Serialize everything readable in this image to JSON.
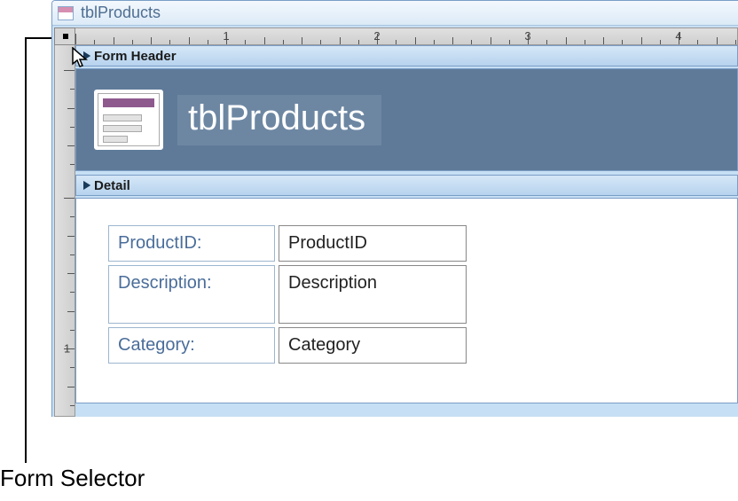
{
  "window": {
    "title": "tblProducts"
  },
  "ruler": {
    "numbers": [
      "1",
      "2",
      "3",
      "4"
    ],
    "vnumbers": [
      "1"
    ]
  },
  "sections": {
    "header_label": "Form Header",
    "detail_label": "Detail"
  },
  "form_header": {
    "title": "tblProducts"
  },
  "fields": [
    {
      "label": "ProductID:",
      "value": "ProductID",
      "tall": false
    },
    {
      "label": "Description:",
      "value": "Description",
      "tall": true
    },
    {
      "label": "Category:",
      "value": "Category",
      "tall": false
    }
  ],
  "callout": {
    "label": "Form Selector"
  }
}
